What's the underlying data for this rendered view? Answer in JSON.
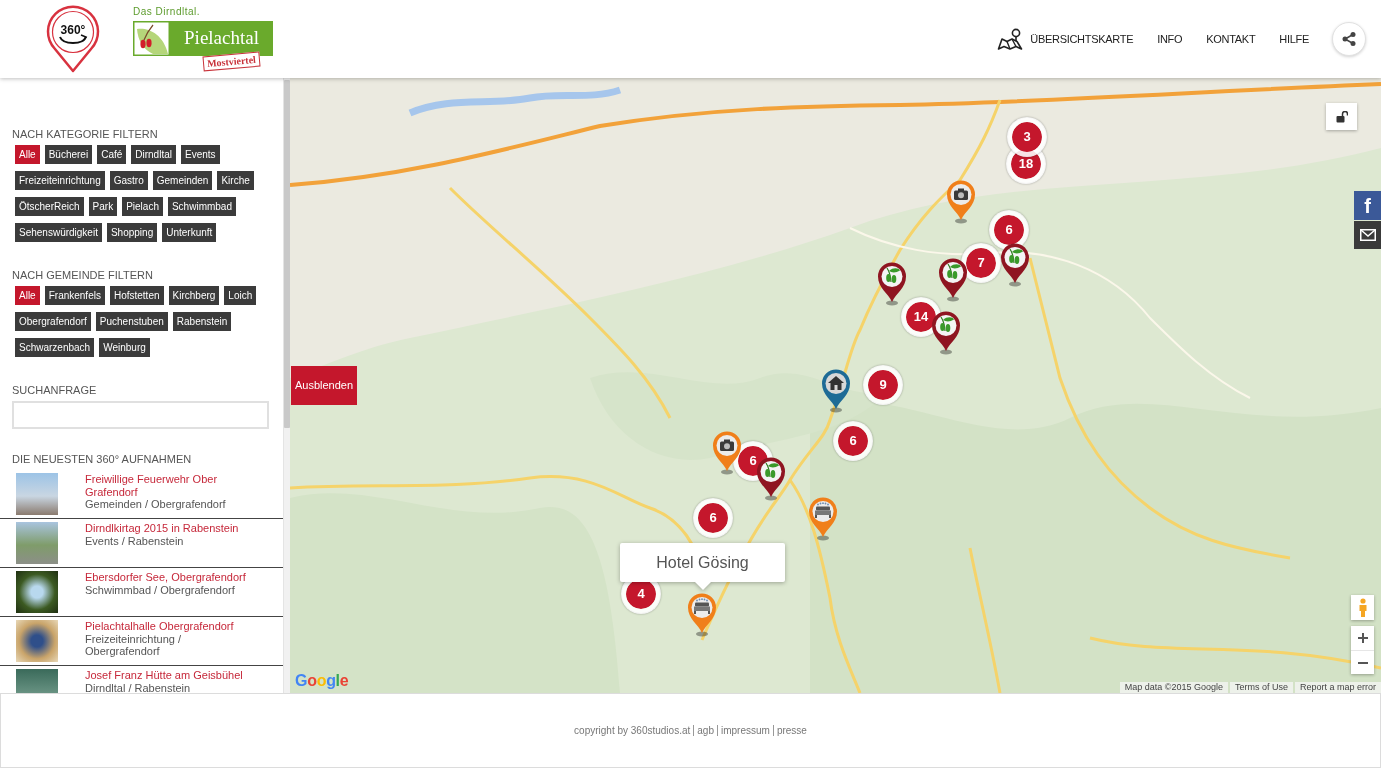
{
  "header": {
    "panorama_logo": "360°",
    "tagline": "Das Dirndltal.",
    "wordmark": "Pielachtal",
    "stamp": "Mostviertel",
    "nav": [
      {
        "label": "ÜBERSICHTSKARTE",
        "kind": "map"
      },
      {
        "label": "INFO",
        "kind": "text"
      },
      {
        "label": "KONTAKT",
        "kind": "text"
      },
      {
        "label": "HILFE",
        "kind": "text"
      }
    ]
  },
  "sidebar": {
    "category_filter": {
      "heading": "NACH KATEGORIE FILTERN",
      "tags": [
        {
          "label": "Alle",
          "selected": true
        },
        {
          "label": "Bücherei",
          "selected": false
        },
        {
          "label": "Café",
          "selected": false
        },
        {
          "label": "Dirndltal",
          "selected": false
        },
        {
          "label": "Events",
          "selected": false
        },
        {
          "label": "Freizeiteinrichtung",
          "selected": false
        },
        {
          "label": "Gastro",
          "selected": false
        },
        {
          "label": "Gemeinden",
          "selected": false
        },
        {
          "label": "Kirche",
          "selected": false
        },
        {
          "label": "ÖtscherReich",
          "selected": false
        },
        {
          "label": "Park",
          "selected": false
        },
        {
          "label": "Pielach",
          "selected": false
        },
        {
          "label": "Schwimmbad",
          "selected": false
        },
        {
          "label": "Sehenswürdigkeit",
          "selected": false
        },
        {
          "label": "Shopping",
          "selected": false
        },
        {
          "label": "Unterkunft",
          "selected": false
        }
      ]
    },
    "municipality_filter": {
      "heading": "NACH GEMEINDE FILTERN",
      "tags": [
        {
          "label": "Alle",
          "selected": true
        },
        {
          "label": "Frankenfels",
          "selected": false
        },
        {
          "label": "Hofstetten",
          "selected": false
        },
        {
          "label": "Kirchberg",
          "selected": false
        },
        {
          "label": "Loich",
          "selected": false
        },
        {
          "label": "Obergrafendorf",
          "selected": false
        },
        {
          "label": "Puchenstuben",
          "selected": false
        },
        {
          "label": "Rabenstein",
          "selected": false
        },
        {
          "label": "Schwarzenbach",
          "selected": false
        },
        {
          "label": "Weinburg",
          "selected": false
        }
      ]
    },
    "search": {
      "label": "SUCHANFRAGE"
    },
    "latest": {
      "heading": "DIE NEUESTEN 360° AUFNAHMEN",
      "items": [
        {
          "title": "Freiwillige Feuerwehr Ober Grafendorf",
          "subtitle": "Gemeinden / Obergrafendorf"
        },
        {
          "title": "Dirndlkirtag 2015 in Rabenstein",
          "subtitle": "Events / Rabenstein"
        },
        {
          "title": "Ebersdorfer See, Obergrafendorf",
          "subtitle": "Schwimmbad / Obergrafendorf"
        },
        {
          "title": "Pielachtalhalle Obergrafendorf",
          "subtitle": "Freizeiteinrichtung / Obergrafendorf"
        },
        {
          "title": "Josef Franz Hütte am Geisbühel",
          "subtitle": "Dirndltal / Rabenstein"
        }
      ]
    }
  },
  "map": {
    "hide_button": "Ausblenden",
    "social": [
      {
        "kind": "facebook",
        "glyph": "f"
      },
      {
        "kind": "email"
      }
    ],
    "clusters": [
      {
        "count": "3"
      },
      {
        "count": "18"
      },
      {
        "count": "6"
      },
      {
        "count": "7"
      },
      {
        "count": "14"
      },
      {
        "count": "9"
      },
      {
        "count": "6"
      },
      {
        "count": "6"
      },
      {
        "count": "6"
      },
      {
        "count": "4"
      }
    ],
    "pins": [
      {
        "kind": "camera"
      },
      {
        "kind": "leaf"
      },
      {
        "kind": "leaf"
      },
      {
        "kind": "leaf"
      },
      {
        "kind": "leaf"
      },
      {
        "kind": "house"
      },
      {
        "kind": "leaf"
      },
      {
        "kind": "camera"
      },
      {
        "kind": "bed"
      },
      {
        "kind": "bed"
      }
    ],
    "tooltip": "Hotel Gösing",
    "google_logo": "Google",
    "attribution": [
      "Map data ©2015 Google",
      "Terms of Use",
      "Report a map error"
    ]
  },
  "footer": {
    "items": [
      "copyright by 360studios.at",
      "agb",
      "impressum",
      "presse"
    ]
  }
}
